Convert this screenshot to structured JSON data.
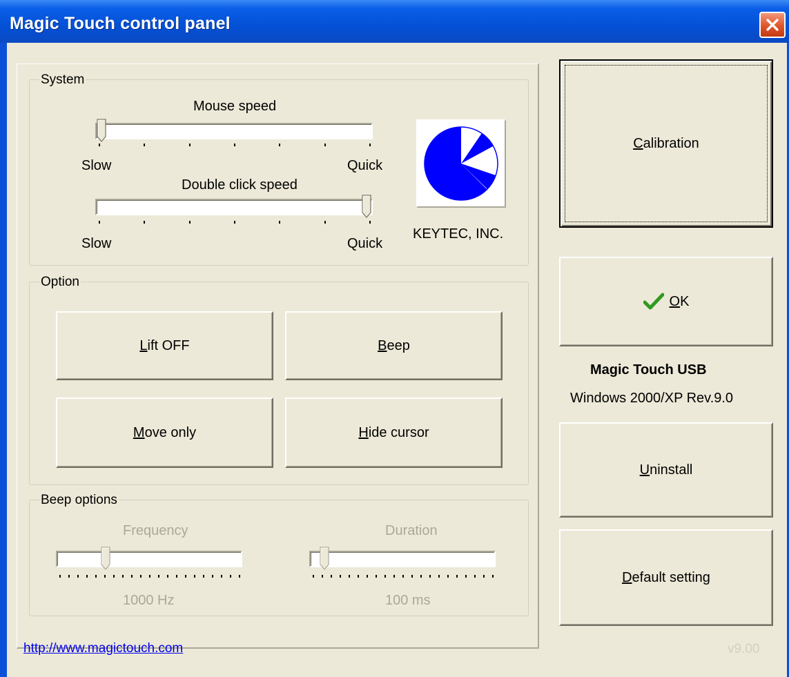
{
  "window": {
    "title": "Magic Touch control panel"
  },
  "system": {
    "group_label": "System",
    "mouse_speed": {
      "label": "Mouse speed",
      "min_label": "Slow",
      "max_label": "Quick",
      "level": 0.0
    },
    "double_click_speed": {
      "label": "Double click speed",
      "min_label": "Slow",
      "max_label": "Quick",
      "level": 1.0
    },
    "company": "KEYTEC, INC."
  },
  "option": {
    "group_label": "Option",
    "buttons": {
      "lift_off": {
        "mnemonic": "L",
        "rest": "ift OFF"
      },
      "beep": {
        "mnemonic": "B",
        "rest": "eep"
      },
      "move_only": {
        "mnemonic": "M",
        "rest": "ove only"
      },
      "hide_cursor": {
        "mnemonic": "H",
        "rest": "ide cursor"
      }
    }
  },
  "beep_options": {
    "group_label": "Beep options",
    "frequency": {
      "label": "Frequency",
      "value_text": "1000 Hz",
      "level": 0.25
    },
    "duration": {
      "label": "Duration",
      "value_text": "100 ms",
      "level": 0.05
    }
  },
  "right_panel": {
    "calibration": {
      "mnemonic": "C",
      "rest": "alibration"
    },
    "ok": {
      "mnemonic": "O",
      "rest": "K"
    },
    "product_name": "Magic Touch USB",
    "product_version": "Windows 2000/XP Rev.9.0",
    "uninstall": {
      "mnemonic": "U",
      "rest": "ninstall"
    },
    "default_setting": {
      "mnemonic": "D",
      "rest": "efault setting"
    }
  },
  "footer": {
    "link": "http://www.magictouch.com",
    "version": "v9.00"
  },
  "colors": {
    "titlebar": "#0a51d8",
    "face": "#ece9d8",
    "logo_blue": "#0000ff",
    "link": "#0000ee",
    "check_green": "#2f9a1f"
  }
}
